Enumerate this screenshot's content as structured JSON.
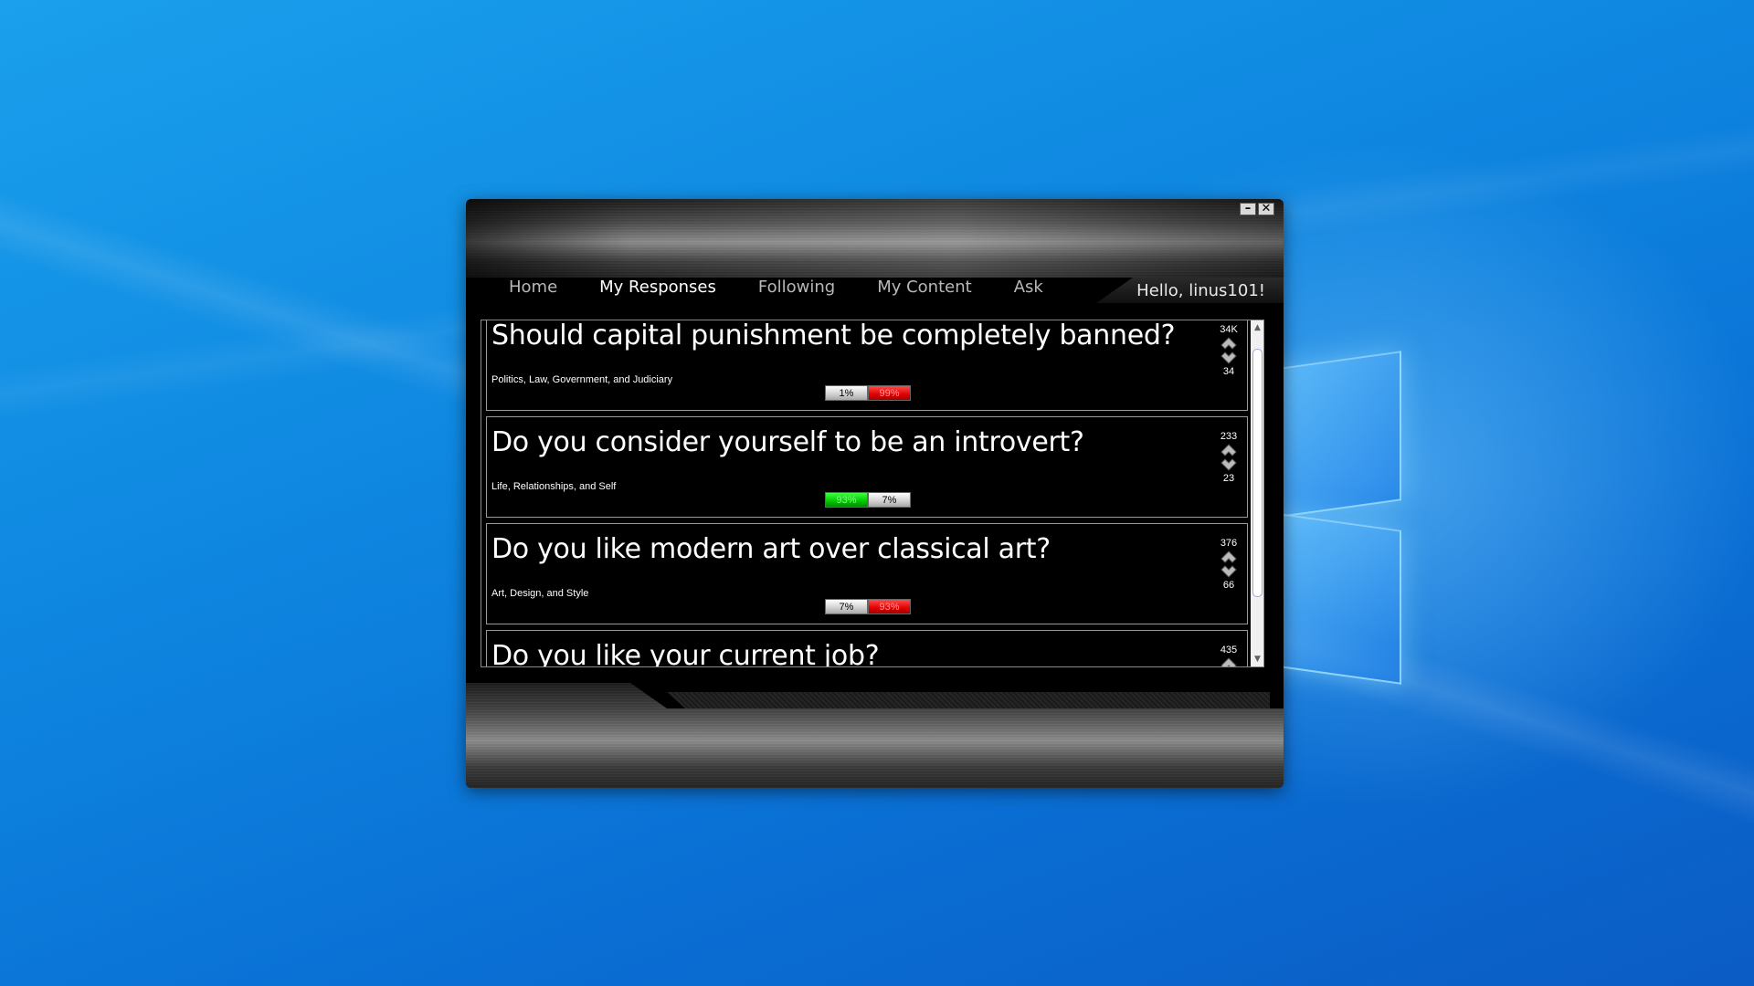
{
  "window": {
    "minimize_label": "–",
    "close_label": "✕"
  },
  "nav": {
    "tabs": [
      {
        "label": "Home",
        "active": false
      },
      {
        "label": "My Responses",
        "active": true
      },
      {
        "label": "Following",
        "active": false
      },
      {
        "label": "My Content",
        "active": false
      },
      {
        "label": "Ask",
        "active": false
      }
    ],
    "greeting": "Hello, linus101!"
  },
  "questions": [
    {
      "title": "Should capital punishment be completely banned?",
      "category": "Politics, Law, Government, and Judiciary",
      "yes_pct": "1%",
      "no_pct": "99%",
      "yes_color": "gray",
      "no_color": "red",
      "upvotes": "34K",
      "downvotes": "34"
    },
    {
      "title": "Do you consider yourself to be an introvert?",
      "category": "Life, Relationships, and Self",
      "yes_pct": "93%",
      "no_pct": "7%",
      "yes_color": "green",
      "no_color": "gray",
      "upvotes": "233",
      "downvotes": "23"
    },
    {
      "title": "Do you like modern art over classical art?",
      "category": "Art, Design, and Style",
      "yes_pct": "7%",
      "no_pct": "93%",
      "yes_color": "gray",
      "no_color": "red",
      "upvotes": "376",
      "downvotes": "66"
    },
    {
      "title": "Do you like your current job?",
      "upvotes": "435"
    }
  ],
  "scrollbar": {
    "up_arrow": "▲",
    "down_arrow": "▼"
  },
  "colors": {
    "desktop": "#0e86e0",
    "window_bg": "#000000",
    "red_bar": "#e00000",
    "green_bar": "#00c800"
  }
}
